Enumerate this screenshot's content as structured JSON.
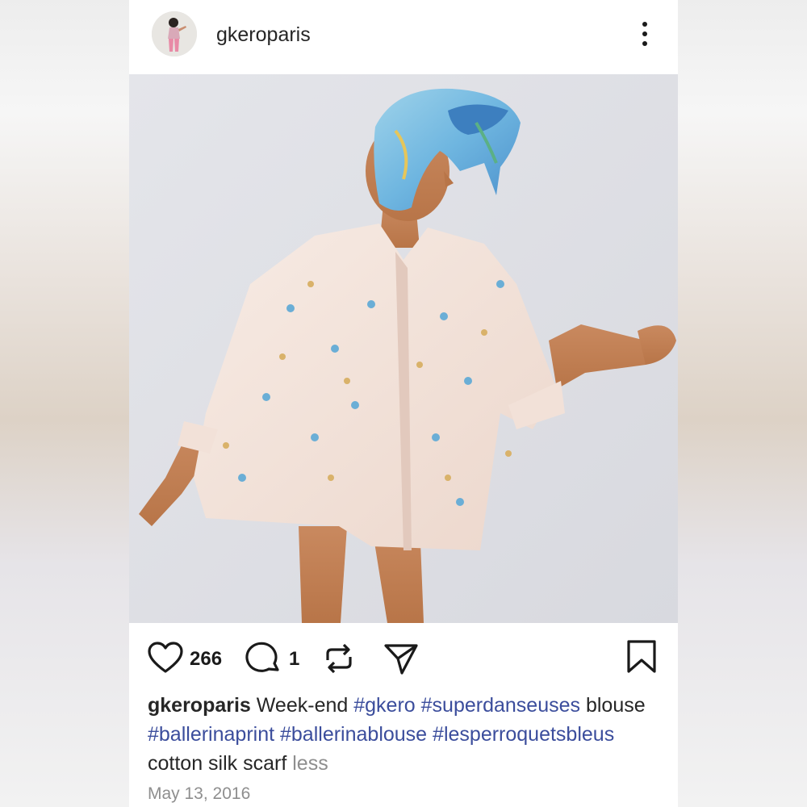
{
  "post": {
    "username": "gkeroparis",
    "photo_alt": "Model wearing ballerina print blouse and blue silk scarf"
  },
  "actions": {
    "likes": "266",
    "comments": "1"
  },
  "caption": {
    "username": "gkeroparis",
    "text_1": " Week-end ",
    "tag_1": "#gkero",
    "sp_1": " ",
    "tag_2": "#superdanseuses",
    "text_2": " blouse ",
    "tag_3": "#ballerinaprint",
    "sp_2": " ",
    "tag_4": "#ballerinablouse",
    "sp_3": " ",
    "tag_5": "#lesperroquetsbleus",
    "text_3": " cotton silk scarf ",
    "less_label": "less"
  },
  "date": "May 13, 2016",
  "colors": {
    "hashtag": "#3b4d9c",
    "muted": "#8e8e8e",
    "text": "#262626"
  }
}
